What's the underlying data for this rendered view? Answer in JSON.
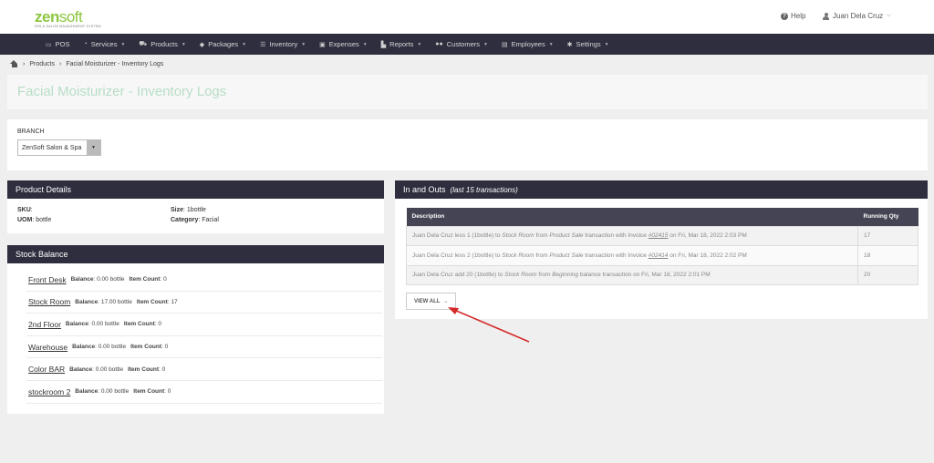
{
  "logo": {
    "zen": "zen",
    "soft": "soft",
    "tagline": "SPA & SALON MANAGEMENT SYSTEM"
  },
  "header": {
    "help_label": "Help",
    "user_name": "Juan Dela Cruz"
  },
  "nav": [
    {
      "label": "POS",
      "icon": "pos-icon"
    },
    {
      "label": "Services",
      "icon": "services-icon"
    },
    {
      "label": "Products",
      "icon": "products-icon"
    },
    {
      "label": "Packages",
      "icon": "packages-icon"
    },
    {
      "label": "Inventory",
      "icon": "inventory-icon"
    },
    {
      "label": "Expenses",
      "icon": "expenses-icon"
    },
    {
      "label": "Reports",
      "icon": "reports-icon"
    },
    {
      "label": "Customers",
      "icon": "customers-icon"
    },
    {
      "label": "Employees",
      "icon": "employees-icon"
    },
    {
      "label": "Settings",
      "icon": "settings-icon"
    }
  ],
  "breadcrumb": {
    "products": "Products",
    "current": "Facial Moisturizer - Inventory Logs"
  },
  "page_title": "Facial Moisturizer - Inventory Logs",
  "branch": {
    "label": "BRANCH",
    "selected": "ZenSoft Salon & Spa"
  },
  "product_details": {
    "title": "Product Details",
    "sku_label": "SKU",
    "sku_value": "",
    "size_label": "Size",
    "size_value": "1bottle",
    "uom_label": "UOM",
    "uom_value": "bottle",
    "category_label": "Category",
    "category_value": "Facial"
  },
  "stock_balance": {
    "title": "Stock Balance",
    "balance_label": "Balance",
    "item_count_label": "Item Count",
    "rows": [
      {
        "location": "Front Desk",
        "balance": "0.00 bottle",
        "count": "0"
      },
      {
        "location": "Stock Room",
        "balance": "17.00 bottle",
        "count": "17"
      },
      {
        "location": "2nd Floor",
        "balance": "0.00 bottle",
        "count": "0"
      },
      {
        "location": "Warehouse",
        "balance": "0.00 bottle",
        "count": "0"
      },
      {
        "location": "Color BAR",
        "balance": "0.00 bottle",
        "count": "0"
      },
      {
        "location": "stockroom 2",
        "balance": "0.00 bottle",
        "count": "0"
      }
    ]
  },
  "in_outs": {
    "title": "In and Outs",
    "subtitle": "(last 15 transactions)",
    "col_description": "Description",
    "col_qty": "Running Qty",
    "rows": [
      {
        "p1": "Juan Dela Cruz less 1 (1bottle) to ",
        "loc": "Stock Room",
        "p2": " from ",
        "src": "Product Sale",
        "p3": " transaction with Invoice ",
        "inv": "#02415",
        "p4": " on Fri, Mar 18, 2022 2:03 PM",
        "qty": "17"
      },
      {
        "p1": "Juan Dela Cruz less 2 (1bottle) to ",
        "loc": "Stock Room",
        "p2": " from ",
        "src": "Product Sale",
        "p3": " transaction with Invoice ",
        "inv": "#02414",
        "p4": " on Fri, Mar 18, 2022 2:02 PM",
        "qty": "18"
      },
      {
        "p1": "Juan Dela Cruz add 20 (1bottle) to ",
        "loc": "Stock Room",
        "p2": " from ",
        "src": "Beginning",
        "p3": " balance transaction on Fri, Mar 18, 2022 2:01 PM",
        "inv": "",
        "p4": "",
        "qty": "20"
      }
    ],
    "view_all_label": "VIEW ALL"
  },
  "colors": {
    "nav_bg": "#2e2e3f",
    "accent_green": "#8cc63f",
    "title_green": "#b7ddc6",
    "annotation_red": "#d42a2a"
  }
}
